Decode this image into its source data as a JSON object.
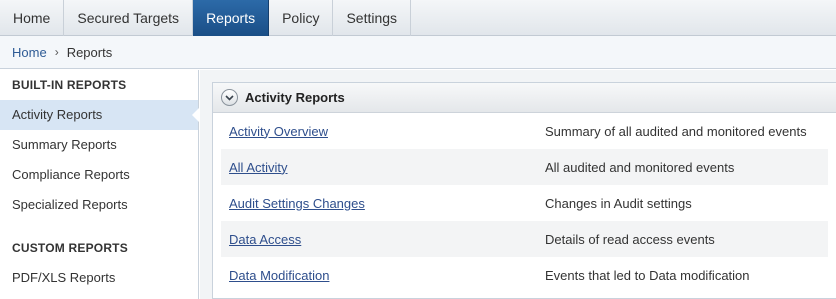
{
  "nav": {
    "tabs": [
      {
        "label": "Home"
      },
      {
        "label": "Secured Targets"
      },
      {
        "label": "Reports"
      },
      {
        "label": "Policy"
      },
      {
        "label": "Settings"
      }
    ],
    "active_tab": "Reports"
  },
  "breadcrumb": {
    "home": "Home",
    "separator": "›",
    "current": "Reports"
  },
  "sidebar": {
    "builtin_title": "BUILT-IN REPORTS",
    "builtin_items": [
      {
        "label": "Activity Reports"
      },
      {
        "label": "Summary Reports"
      },
      {
        "label": "Compliance Reports"
      },
      {
        "label": "Specialized Reports"
      }
    ],
    "custom_title": "CUSTOM REPORTS",
    "custom_items": [
      {
        "label": "PDF/XLS Reports"
      }
    ]
  },
  "panel": {
    "title": "Activity Reports",
    "icon": "chevron-down-icon",
    "rows": [
      {
        "name": "Activity Overview",
        "description": "Summary of all audited and monitored events"
      },
      {
        "name": "All Activity",
        "description": "All audited and monitored events"
      },
      {
        "name": "Audit Settings Changes",
        "description": "Changes in Audit settings"
      },
      {
        "name": "Data Access",
        "description": "Details of read access events"
      },
      {
        "name": "Data Modification",
        "description": "Events that led to Data modification"
      }
    ]
  },
  "colors": {
    "active_tab": "#1f5a96",
    "link": "#2e4e8c",
    "sidebar_active": "#d7e5f4"
  }
}
